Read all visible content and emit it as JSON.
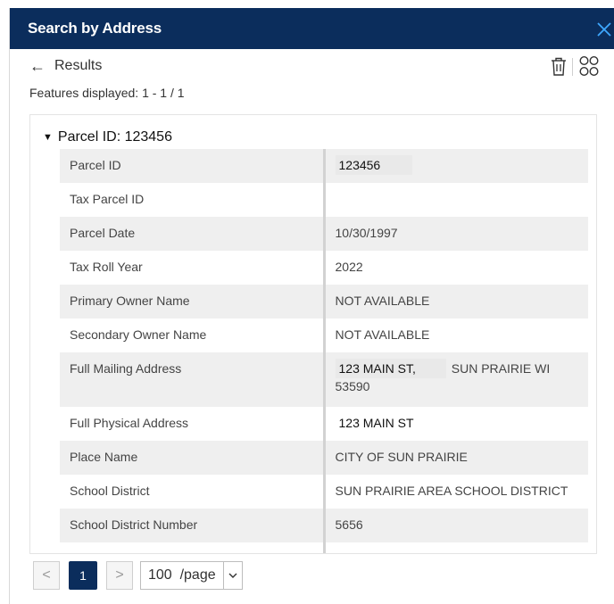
{
  "header": {
    "title": "Search by Address",
    "close_icon": "close-icon",
    "accent_color": "#0b2d5c"
  },
  "toolbar": {
    "back_label": "Results",
    "back_icon": "arrow-left-icon",
    "trash_icon": "trash-icon",
    "grid_icon": "grid-view-icon"
  },
  "features_displayed": "Features displayed: 1 - 1 / 1",
  "group": {
    "label": "Parcel ID: 123456",
    "rows": [
      {
        "key": "Parcel ID",
        "value": "123456"
      },
      {
        "key": "Tax Parcel ID",
        "value": ""
      },
      {
        "key": "Parcel Date",
        "value": "10/30/1997"
      },
      {
        "key": "Tax Roll Year",
        "value": "2022"
      },
      {
        "key": "Primary Owner Name",
        "value": "NOT AVAILABLE"
      },
      {
        "key": "Secondary Owner Name",
        "value": "NOT AVAILABLE"
      },
      {
        "key": "Full Mailing Address",
        "value_part1": "123 MAIN ST,",
        "value_part2": "SUN PRAIRIE WI",
        "value_line2": "53590"
      },
      {
        "key": "Full Physical Address",
        "value": "123 MAIN ST"
      },
      {
        "key": "Place Name",
        "value": "CITY OF SUN PRAIRIE"
      },
      {
        "key": "School District",
        "value": "SUN PRAIRIE AREA SCHOOL DISTRICT"
      },
      {
        "key": "School District Number",
        "value": "5656"
      },
      {
        "key": "",
        "value": ""
      }
    ]
  },
  "pager": {
    "prev": "<",
    "current": "1",
    "next": ">",
    "page_size": "100  /page",
    "dropdown_icon": "chevron-down-icon"
  }
}
